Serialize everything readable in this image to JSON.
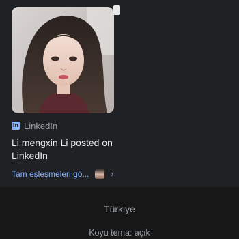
{
  "result": {
    "source_name": "LinkedIn",
    "source_icon": "linkedin-icon",
    "title": "Li mengxin Li posted on LinkedIn",
    "more_link": "Tam eşleşmeleri gö...",
    "more_icon": "chevron-right-icon"
  },
  "footer": {
    "region": "Türkiye",
    "dark_theme": "Koyu tema: açık"
  },
  "colors": {
    "background": "#202124",
    "footer_background": "#171717",
    "link": "#8ab4f8",
    "text_primary": "#e8eaed",
    "text_secondary": "#9aa0a6"
  }
}
